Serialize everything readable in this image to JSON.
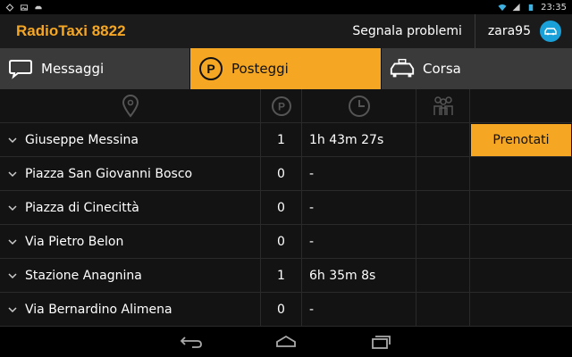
{
  "status_bar": {
    "time": "23:35",
    "icons": [
      "diamond-icon",
      "image-icon",
      "car-icon",
      "wifi-icon",
      "signal-icon",
      "battery-icon"
    ]
  },
  "app": {
    "title": "RadioTaxi 8822",
    "accent_color": "#f5a623",
    "report_label": "Segnala problemi",
    "username": "zara95",
    "avatar_icon": "taxi-icon",
    "avatar_color": "#1aa0d8"
  },
  "tabs": [
    {
      "label": "Messaggi",
      "icon": "chat-bubble-icon",
      "active": false
    },
    {
      "label": "Posteggi",
      "icon": "parking-icon",
      "active": true
    },
    {
      "label": "Corsa",
      "icon": "taxi-car-icon",
      "active": false
    }
  ],
  "table": {
    "header_icons": [
      "location-pin-icon",
      "parking-circle-icon",
      "clock-icon",
      "people-icon"
    ],
    "rows": [
      {
        "name": "Giuseppe Messina",
        "count": "1",
        "time": "1h 43m 27s",
        "action": "Prenotati"
      },
      {
        "name": "Piazza San Giovanni Bosco",
        "count": "0",
        "time": "-",
        "action": ""
      },
      {
        "name": "Piazza di Cinecittà",
        "count": "0",
        "time": "-",
        "action": ""
      },
      {
        "name": "Via Pietro Belon",
        "count": "0",
        "time": "-",
        "action": ""
      },
      {
        "name": "Stazione Anagnina",
        "count": "1",
        "time": "6h 35m 8s",
        "action": ""
      },
      {
        "name": "Via Bernardino Alimena",
        "count": "0",
        "time": "-",
        "action": ""
      }
    ]
  },
  "nav_bar": {
    "icons": [
      "back-icon",
      "home-icon",
      "recent-apps-icon"
    ]
  }
}
